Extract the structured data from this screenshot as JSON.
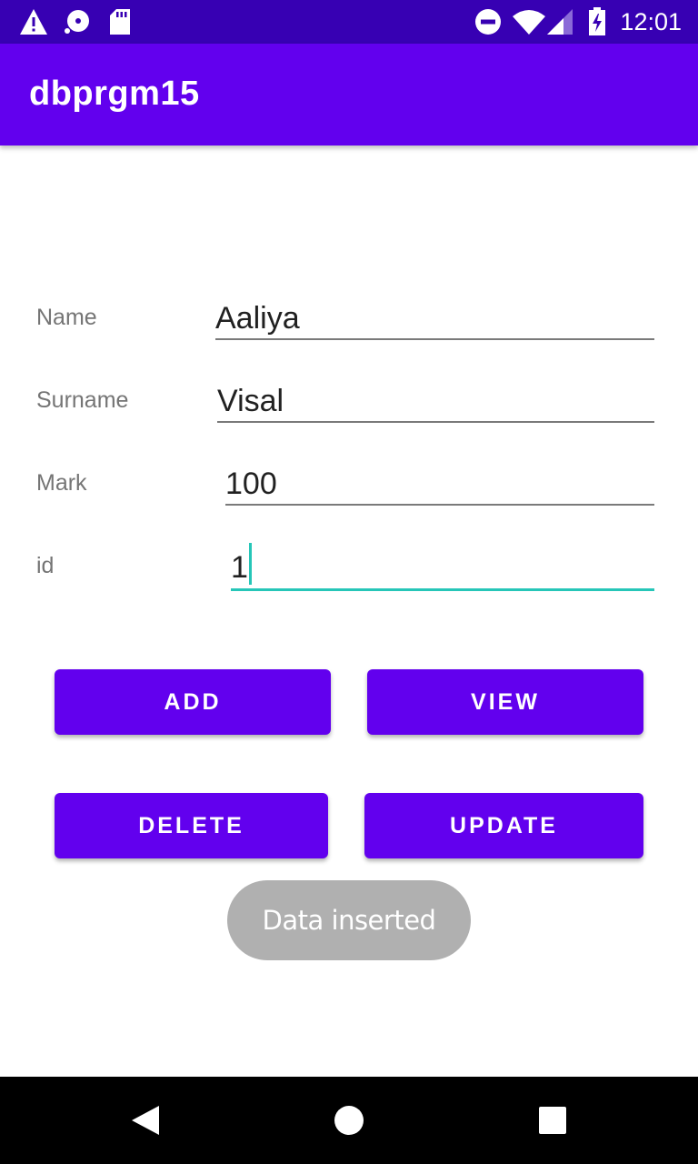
{
  "status_bar": {
    "time": "12:01",
    "icons": [
      "warning-icon",
      "disc-icon",
      "sd-card-icon",
      "do-not-disturb-icon",
      "wifi-icon",
      "signal-icon",
      "battery-icon"
    ]
  },
  "app_bar": {
    "title": "dbprgm15"
  },
  "form": {
    "name_label": "Name",
    "name_value": "Aaliya",
    "surname_label": "Surname",
    "surname_value": "Visal",
    "mark_label": "Mark",
    "mark_value": "100",
    "id_label": "id",
    "id_value": "1"
  },
  "buttons": {
    "add": "ADD",
    "view": "VIEW",
    "delete": "DELETE",
    "update": "UPDATE"
  },
  "toast": {
    "message": "Data inserted"
  },
  "nav_bar": {
    "icons": [
      "back-icon",
      "home-icon",
      "recents-icon"
    ]
  },
  "colors": {
    "primary": "#6200ee",
    "primary_dark": "#3700b3",
    "accent": "#26c6b8",
    "toast_bg": "#b0b0b0"
  }
}
